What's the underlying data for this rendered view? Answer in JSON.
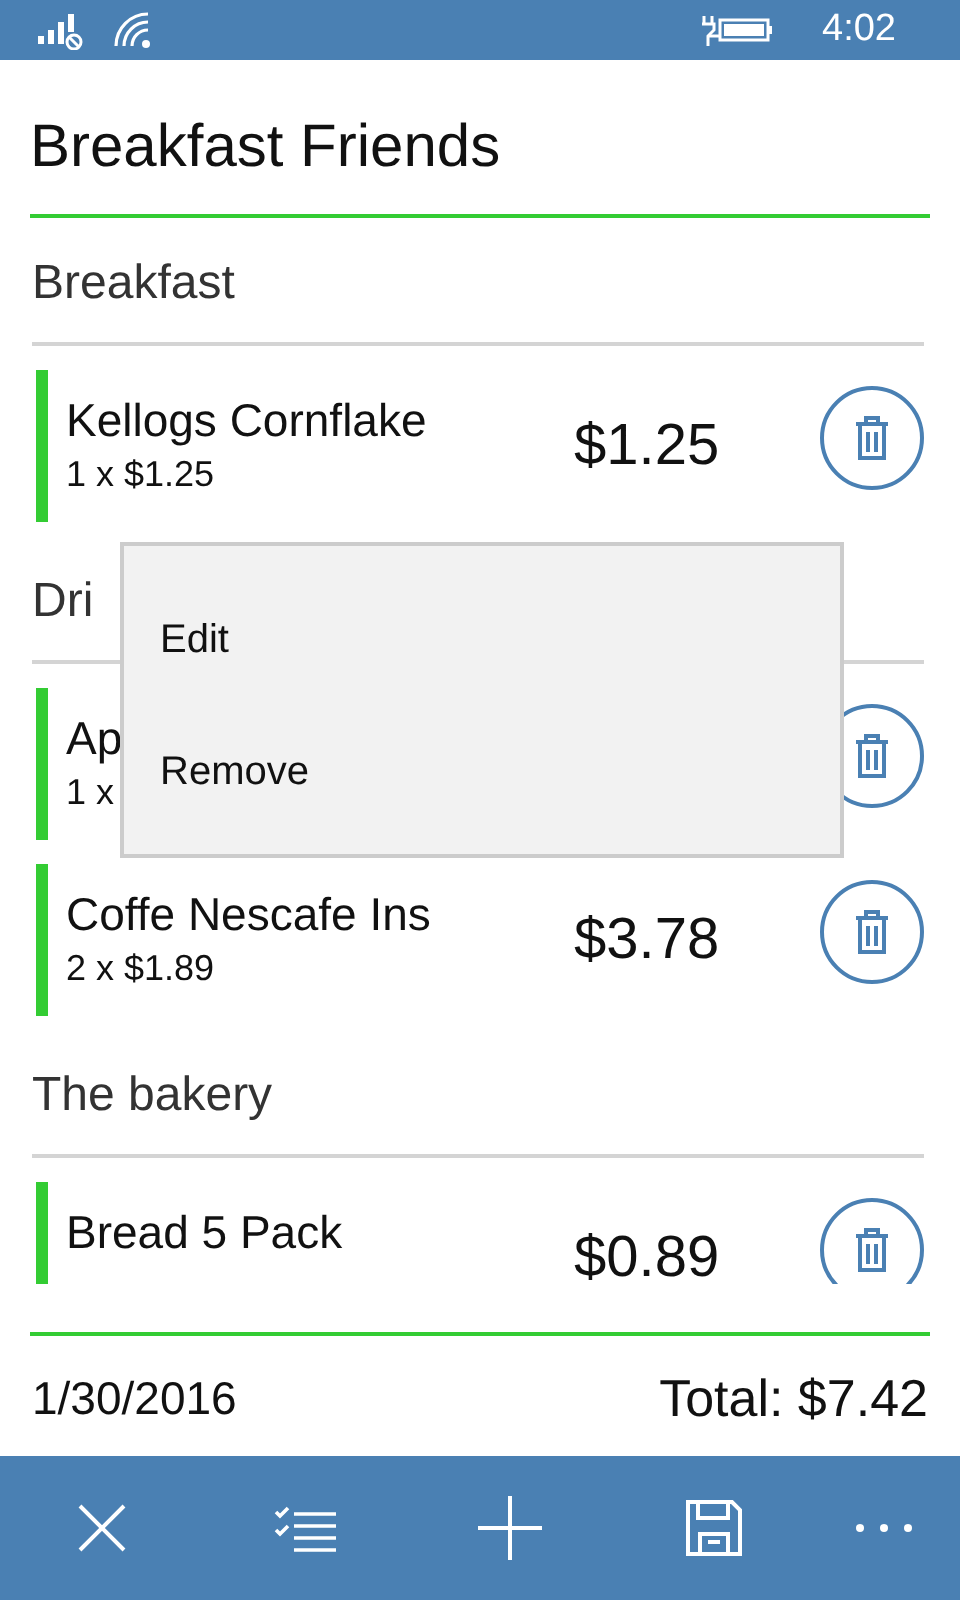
{
  "status_bar": {
    "time": "4:02"
  },
  "title": "Breakfast Friends",
  "sections": [
    {
      "title": "Breakfast",
      "items": [
        {
          "name": "Kellogs Cornflake",
          "quantity": "1 x $1.25",
          "price": "$1.25"
        }
      ]
    },
    {
      "title": "Dri",
      "items": [
        {
          "name": "Ap",
          "quantity": "1 x"
        },
        {
          "name": "Coffe Nescafe Ins",
          "quantity": "2 x $1.89",
          "price": "$3.78"
        }
      ]
    },
    {
      "title": "The bakery",
      "items": [
        {
          "name": "Bread 5 Pack",
          "price": "$0.89"
        }
      ]
    }
  ],
  "context_menu": {
    "items": [
      "Edit",
      "Remove"
    ]
  },
  "footer": {
    "date": "1/30/2016",
    "total": "Total: $7.42"
  },
  "app_bar": {
    "buttons": [
      {
        "kind": "close"
      },
      {
        "kind": "checklist"
      },
      {
        "kind": "add"
      },
      {
        "kind": "save"
      },
      {
        "kind": "more"
      }
    ]
  }
}
